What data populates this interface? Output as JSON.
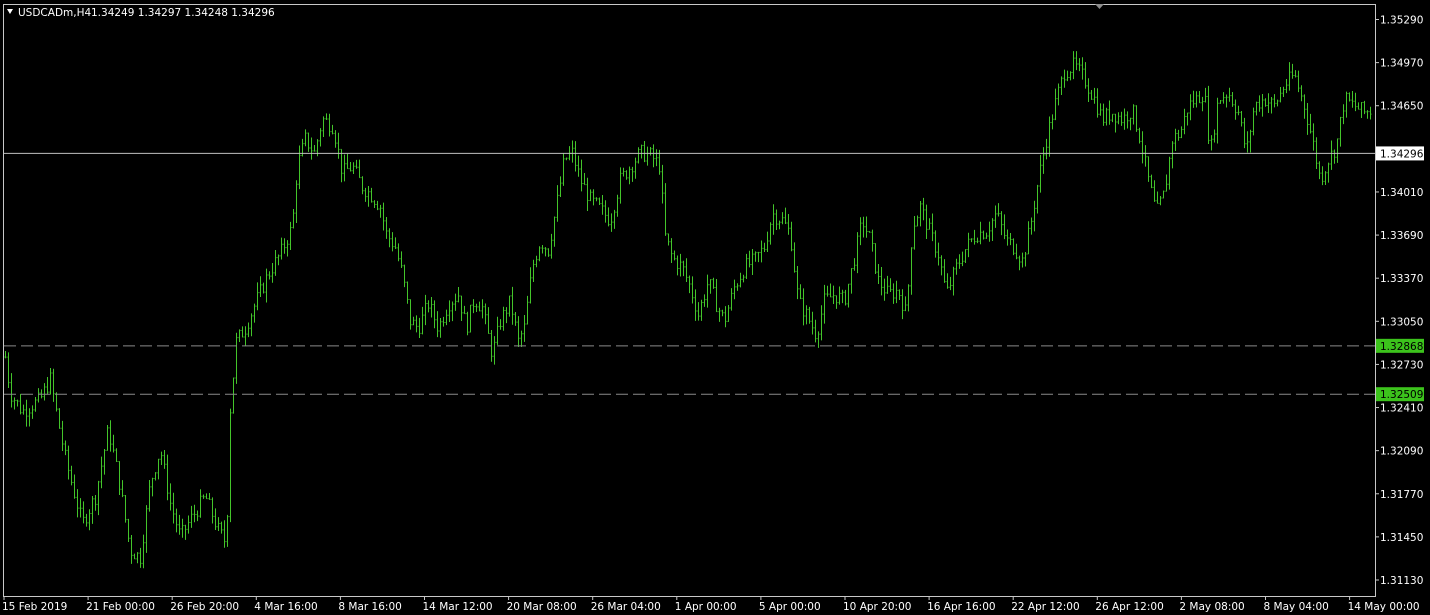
{
  "window": {
    "symbol_label": "USDCADm,H4",
    "ohlc": "1.34249 1.34297 1.34248 1.34296"
  },
  "colors": {
    "background": "#000000",
    "frame": "#c8c8c8",
    "bar": "#43c52a",
    "bid_line": "#c0c0c0",
    "level_line": "#8a8a8a",
    "level_label_bg": "#3cc31c",
    "bid_label_bg": "#ffffff",
    "text": "#ffffff"
  },
  "chart_data": {
    "type": "ohlc",
    "symbol": "USDCADm",
    "timeframe": "H4",
    "ylim": [
      1.3098,
      1.3544
    ],
    "y_ticks": [
      "1.35290",
      "1.34970",
      "1.34650",
      "1.34010",
      "1.33690",
      "1.33370",
      "1.33050",
      "1.32730",
      "1.32410",
      "1.32090",
      "1.31770",
      "1.31450",
      "1.31130"
    ],
    "x_ticks": [
      "15 Feb 2019",
      "21 Feb 00:00",
      "26 Feb 20:00",
      "4 Mar 16:00",
      "8 Mar 16:00",
      "14 Mar 12:00",
      "20 Mar 08:00",
      "26 Mar 04:00",
      "1 Apr 00:00",
      "5 Apr 00:00",
      "10 Apr 20:00",
      "16 Apr 16:00",
      "22 Apr 12:00",
      "26 Apr 12:00",
      "2 May 08:00",
      "8 May 04:00",
      "14 May 00:00"
    ],
    "bid_line": {
      "value": 1.34296,
      "label": "1.34296"
    },
    "horizontal_levels": [
      {
        "value": 1.32868,
        "label": "1.32868"
      },
      {
        "value": 1.32509,
        "label": "1.32509"
      }
    ],
    "close_path": [
      [
        0,
        1.3305
      ],
      [
        10,
        1.3252
      ],
      [
        22,
        1.3238
      ],
      [
        40,
        1.3247
      ],
      [
        50,
        1.3262
      ],
      [
        58,
        1.323
      ],
      [
        66,
        1.32
      ],
      [
        82,
        1.3155
      ],
      [
        95,
        1.3175
      ],
      [
        108,
        1.3225
      ],
      [
        118,
        1.319
      ],
      [
        130,
        1.3135
      ],
      [
        140,
        1.313
      ],
      [
        150,
        1.3185
      ],
      [
        160,
        1.321
      ],
      [
        170,
        1.317
      ],
      [
        180,
        1.3145
      ],
      [
        192,
        1.316
      ],
      [
        205,
        1.3175
      ],
      [
        218,
        1.315
      ],
      [
        226,
        1.314
      ],
      [
        230,
        1.324
      ],
      [
        236,
        1.329
      ],
      [
        245,
        1.33
      ],
      [
        256,
        1.332
      ],
      [
        268,
        1.334
      ],
      [
        280,
        1.3355
      ],
      [
        292,
        1.3375
      ],
      [
        297,
        1.342
      ],
      [
        305,
        1.344
      ],
      [
        314,
        1.343
      ],
      [
        322,
        1.3455
      ],
      [
        333,
        1.345
      ],
      [
        342,
        1.3415
      ],
      [
        352,
        1.342
      ],
      [
        362,
        1.3405
      ],
      [
        372,
        1.3398
      ],
      [
        380,
        1.339
      ],
      [
        386,
        1.337
      ],
      [
        395,
        1.336
      ],
      [
        402,
        1.334
      ],
      [
        410,
        1.3305
      ],
      [
        418,
        1.33
      ],
      [
        428,
        1.3318
      ],
      [
        438,
        1.33
      ],
      [
        448,
        1.3318
      ],
      [
        458,
        1.3325
      ],
      [
        466,
        1.33
      ],
      [
        474,
        1.3322
      ],
      [
        482,
        1.3315
      ],
      [
        492,
        1.328
      ],
      [
        500,
        1.3305
      ],
      [
        510,
        1.332
      ],
      [
        518,
        1.329
      ],
      [
        524,
        1.33
      ],
      [
        532,
        1.3345
      ],
      [
        540,
        1.3365
      ],
      [
        548,
        1.3358
      ],
      [
        556,
        1.339
      ],
      [
        564,
        1.3425
      ],
      [
        572,
        1.343
      ],
      [
        580,
        1.341
      ],
      [
        590,
        1.3395
      ],
      [
        600,
        1.3388
      ],
      [
        610,
        1.338
      ],
      [
        620,
        1.341
      ],
      [
        630,
        1.342
      ],
      [
        640,
        1.343
      ],
      [
        650,
        1.3428
      ],
      [
        660,
        1.342
      ],
      [
        664,
        1.337
      ],
      [
        672,
        1.3352
      ],
      [
        682,
        1.3345
      ],
      [
        690,
        1.333
      ],
      [
        698,
        1.331
      ],
      [
        708,
        1.3335
      ],
      [
        716,
        1.3318
      ],
      [
        724,
        1.3305
      ],
      [
        734,
        1.333
      ],
      [
        744,
        1.3345
      ],
      [
        754,
        1.335
      ],
      [
        764,
        1.336
      ],
      [
        772,
        1.3385
      ],
      [
        782,
        1.338
      ],
      [
        790,
        1.337
      ],
      [
        798,
        1.332
      ],
      [
        806,
        1.331
      ],
      [
        816,
        1.3295
      ],
      [
        824,
        1.332
      ],
      [
        834,
        1.3325
      ],
      [
        844,
        1.332
      ],
      [
        852,
        1.3345
      ],
      [
        862,
        1.338
      ],
      [
        870,
        1.3365
      ],
      [
        878,
        1.3335
      ],
      [
        888,
        1.3325
      ],
      [
        898,
        1.3328
      ],
      [
        906,
        1.331
      ],
      [
        912,
        1.3375
      ],
      [
        920,
        1.339
      ],
      [
        930,
        1.337
      ],
      [
        938,
        1.3355
      ],
      [
        946,
        1.3325
      ],
      [
        956,
        1.3345
      ],
      [
        966,
        1.336
      ],
      [
        976,
        1.337
      ],
      [
        986,
        1.3372
      ],
      [
        996,
        1.3385
      ],
      [
        1006,
        1.3365
      ],
      [
        1014,
        1.336
      ],
      [
        1022,
        1.335
      ],
      [
        1030,
        1.3375
      ],
      [
        1038,
        1.341
      ],
      [
        1046,
        1.344
      ],
      [
        1056,
        1.347
      ],
      [
        1064,
        1.349
      ],
      [
        1074,
        1.3495
      ],
      [
        1084,
        1.3485
      ],
      [
        1094,
        1.347
      ],
      [
        1102,
        1.3455
      ],
      [
        1112,
        1.346
      ],
      [
        1122,
        1.3455
      ],
      [
        1132,
        1.3462
      ],
      [
        1140,
        1.344
      ],
      [
        1148,
        1.341
      ],
      [
        1156,
        1.3385
      ],
      [
        1164,
        1.34
      ],
      [
        1172,
        1.344
      ],
      [
        1180,
        1.3445
      ],
      [
        1188,
        1.3465
      ],
      [
        1196,
        1.347
      ],
      [
        1204,
        1.3475
      ],
      [
        1210,
        1.343
      ],
      [
        1218,
        1.347
      ],
      [
        1228,
        1.3475
      ],
      [
        1238,
        1.346
      ],
      [
        1246,
        1.343
      ],
      [
        1254,
        1.3465
      ],
      [
        1264,
        1.347
      ],
      [
        1274,
        1.3465
      ],
      [
        1284,
        1.348
      ],
      [
        1294,
        1.3488
      ],
      [
        1304,
        1.3465
      ],
      [
        1312,
        1.344
      ],
      [
        1320,
        1.341
      ],
      [
        1328,
        1.3425
      ],
      [
        1336,
        1.3435
      ],
      [
        1344,
        1.347
      ],
      [
        1354,
        1.3465
      ],
      [
        1364,
        1.346
      ],
      [
        1372,
        1.3462
      ]
    ]
  }
}
